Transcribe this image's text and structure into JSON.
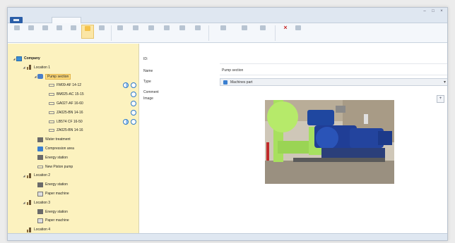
{
  "window": {
    "title": "",
    "controls": [
      "minimize-icon",
      "maximize-icon",
      "close-icon"
    ]
  },
  "ribbon": {
    "tabs": [
      {
        "label": ""
      },
      {
        "label": ""
      },
      {
        "label": ""
      },
      {
        "label": ""
      },
      {
        "label": ""
      }
    ],
    "user_label": "",
    "buttons": [
      {
        "name": "toolbar-button-1",
        "label": "",
        "icon": "tool-icon"
      },
      {
        "name": "toolbar-button-2",
        "label": "",
        "icon": "tool-icon"
      },
      {
        "name": "toolbar-button-3",
        "label": "",
        "icon": "tool-icon"
      },
      {
        "name": "toolbar-button-4",
        "label": "",
        "icon": "tool-icon"
      },
      {
        "name": "toolbar-button-5",
        "label": "",
        "icon": "tool-icon"
      },
      {
        "name": "toolbar-button-6",
        "label": "",
        "icon": "tool-icon",
        "highlighted": true
      },
      {
        "name": "toolbar-button-7",
        "label": "",
        "icon": "tool-icon"
      },
      {
        "name": "delete-button",
        "label": "",
        "icon": "close-icon"
      }
    ]
  },
  "tree": {
    "items": [
      {
        "label": "Company",
        "icon": "company-icon",
        "depth": 0,
        "expander": "▲"
      },
      {
        "label": "Location 1",
        "icon": "location-icon",
        "depth": 1,
        "expander": "▲"
      },
      {
        "label": "Pump section",
        "icon": "pump-icon",
        "depth": 2,
        "expander": "▲",
        "selected": true
      },
      {
        "label": "FM09-AF 14-12",
        "icon": "sensor-icon",
        "depth": 3,
        "status": [
          "partial",
          "ok"
        ]
      },
      {
        "label": "BM025-AC 15-15",
        "icon": "sensor-icon",
        "depth": 3,
        "status": [
          "ok"
        ]
      },
      {
        "label": "GA027-AF 16-60",
        "icon": "sensor-icon",
        "depth": 3,
        "status": [
          "ok"
        ]
      },
      {
        "label": "ZA025-BN 14-16",
        "icon": "sensor-icon",
        "depth": 3,
        "status": [
          "ok"
        ]
      },
      {
        "label": "LB574 CF 16-50",
        "icon": "sensor-icon",
        "depth": 3,
        "status": [
          "partial",
          "ok"
        ]
      },
      {
        "label": "ZA025-BN 14-16",
        "icon": "sensor-icon",
        "depth": 3,
        "status": []
      },
      {
        "label": "Water treatment",
        "icon": "machine-icon",
        "depth": 2
      },
      {
        "label": "Compression area",
        "icon": "blue-icon",
        "depth": 2
      },
      {
        "label": "Energy station",
        "icon": "machine-icon",
        "depth": 2
      },
      {
        "label": "New Piston pump",
        "icon": "sensor-icon",
        "depth": 2
      },
      {
        "label": "Location 2",
        "icon": "location-icon",
        "depth": 1,
        "expander": "▲"
      },
      {
        "label": "Energy station",
        "icon": "machine-icon",
        "depth": 2
      },
      {
        "label": "Paper machine",
        "icon": "paper-icon",
        "depth": 2
      },
      {
        "label": "Location 3",
        "icon": "location-icon",
        "depth": 1,
        "expander": "▲"
      },
      {
        "label": "Energy station",
        "icon": "machine-icon",
        "depth": 2
      },
      {
        "label": "Paper machine",
        "icon": "paper-icon",
        "depth": 2
      },
      {
        "label": "Location 4",
        "icon": "location-icon",
        "depth": 1
      }
    ]
  },
  "form": {
    "id_label": "ID:",
    "name_label": "Name",
    "name_value": "Pump section",
    "type_label": "Type",
    "type_value": "Machines part",
    "comment_label": "Comment",
    "image_label": "Image",
    "image_action": "+"
  },
  "statusbar": {
    "left": "",
    "middle": "",
    "right": ""
  },
  "colors": {
    "tree_bg": "#fcf2bf",
    "selection": "#fbd97a",
    "accent": "#2a78c8"
  }
}
